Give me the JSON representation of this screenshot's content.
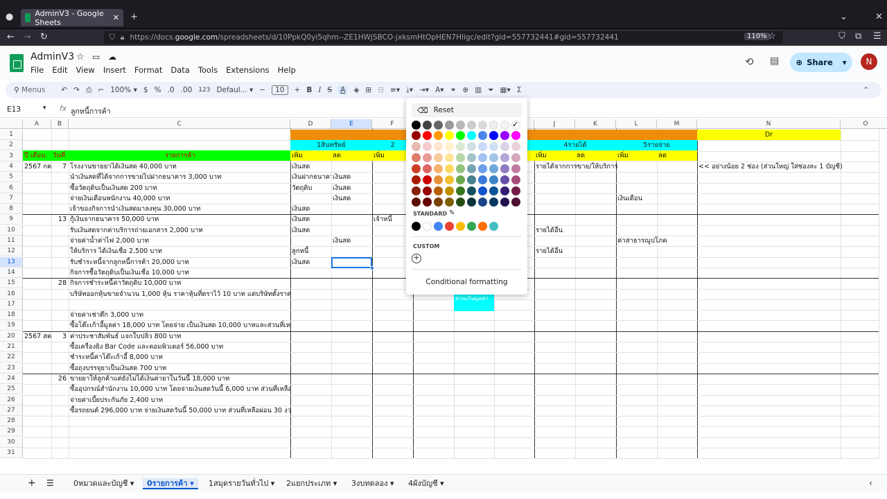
{
  "browser": {
    "tab_title": "AdminV3 - Google Sheets",
    "url_prefix": "https://docs.",
    "url_host": "google.com",
    "url_path": "/spreadsheets/d/10PpkQ0yi5qhm--ZE1HWjSBCO-jxksmHtOpHEN7Hligc/edit?gid=557732441#gid=557732441",
    "zoom": "110%"
  },
  "app": {
    "doc_title": "AdminV3",
    "menu": [
      "File",
      "Edit",
      "View",
      "Insert",
      "Format",
      "Data",
      "Tools",
      "Extensions",
      "Help"
    ],
    "share_label": "Share",
    "avatar_letter": "N"
  },
  "toolbar": {
    "search_label": "Menus",
    "zoom": "100%",
    "currency": "$",
    "percent": "%",
    "dec_less": ".0",
    "dec_more": ".00",
    "number_fmt": "123",
    "font": "Defaul...",
    "font_size": "10"
  },
  "formula_bar": {
    "cell_ref": "E13",
    "content": "ลูกหนี้การค้า"
  },
  "grid": {
    "columns": [
      "A",
      "B",
      "C",
      "D",
      "E",
      "F",
      "G",
      "H",
      "I",
      "J",
      "K",
      "L",
      "M",
      "N",
      "O"
    ],
    "rows": [
      "1",
      "2",
      "3",
      "4",
      "5",
      "6",
      "7",
      "8",
      "9",
      "10",
      "11",
      "12",
      "13",
      "14",
      "15",
      "16",
      "17",
      "18",
      "19",
      "20",
      "21",
      "22",
      "23",
      "24",
      "25",
      "26",
      "27",
      "28",
      "29",
      "30",
      "31"
    ],
    "selected_col": "E",
    "selected_row": "13",
    "row1": {
      "n": "Dr"
    },
    "row2": {
      "d": "1สินทรัพย์",
      "f": "2",
      "j": "4รายได้",
      "l": "5รายจ่าย"
    },
    "row3": {
      "a": "ปี เดือน",
      "b": "วันที่",
      "c": "รายการค้า",
      "d": "เพิ่ม",
      "e": "ลด",
      "f": "เพิ่ม",
      "j": "เพิ่ม",
      "k": "ลด",
      "l": "เพิ่ม",
      "m": "ลด"
    },
    "cells": [
      {
        "row": 4,
        "col": "a",
        "text": "2567 กค"
      },
      {
        "row": 4,
        "col": "b",
        "text": "7"
      },
      {
        "row": 4,
        "col": "c",
        "text": "โรงงานขายยาได้เงินสด 40,000 บาท"
      },
      {
        "row": 4,
        "col": "d",
        "text": "เงินสด"
      },
      {
        "row": 4,
        "col": "j",
        "text": "รายได้จากการขาย/ให้บริการ"
      },
      {
        "row": 4,
        "col": "n",
        "text": "<< อย่างน้อย 2 ช่อง (ส่วนใหญ่ ใส่ช่องละ 1 บัญชี)"
      },
      {
        "row": 5,
        "col": "c",
        "text": "นำเงินสดที่ได้จากการขายไปฝากธนาคาร 3,000 บาท"
      },
      {
        "row": 5,
        "col": "d",
        "text": "เงินฝากธนาคาร"
      },
      {
        "row": 5,
        "col": "e",
        "text": "เงินสด"
      },
      {
        "row": 6,
        "col": "c",
        "text": "ซื้อวัตถุดิบเป็นเงินสด 200 บาท"
      },
      {
        "row": 6,
        "col": "d",
        "text": "วัตถุดิบ"
      },
      {
        "row": 6,
        "col": "e",
        "text": "เงินสด"
      },
      {
        "row": 7,
        "col": "c",
        "text": "จ่ายเงินเดือนพนักงาน 40,000 บาท"
      },
      {
        "row": 7,
        "col": "e",
        "text": "เงินสด"
      },
      {
        "row": 7,
        "col": "l",
        "text": "เงินเดือน"
      },
      {
        "row": 8,
        "col": "c",
        "text": "เจ้าของกิจการนำเงินสดมาลงทุน 30,000 บาท"
      },
      {
        "row": 8,
        "col": "d",
        "text": "เงินสด"
      },
      {
        "row": 9,
        "col": "b",
        "text": "13"
      },
      {
        "row": 9,
        "col": "c",
        "text": "กู้เงินจากธนาคาร 50,000 บาท"
      },
      {
        "row": 9,
        "col": "d",
        "text": "เงินสด"
      },
      {
        "row": 9,
        "col": "f",
        "text": "เจ้าหนี้"
      },
      {
        "row": 10,
        "col": "c",
        "text": "รับเงินสดจากค่าบริการถ่ายเอกสาร 2,000 บาท"
      },
      {
        "row": 10,
        "col": "d",
        "text": "เงินสด"
      },
      {
        "row": 10,
        "col": "j",
        "text": "รายได้อื่น"
      },
      {
        "row": 11,
        "col": "c",
        "text": "จ่ายค่าน้ำค่าไฟ 2,000 บาท"
      },
      {
        "row": 11,
        "col": "e",
        "text": "เงินสด"
      },
      {
        "row": 11,
        "col": "l",
        "text": "ค่าสาธารณูปโภค"
      },
      {
        "row": 12,
        "col": "c",
        "text": "ให้บริการ ได้เงินเชื่อ 2,500 บาท"
      },
      {
        "row": 12,
        "col": "d",
        "text": "ลูกหนี้"
      },
      {
        "row": 12,
        "col": "j",
        "text": "รายได้อื่น"
      },
      {
        "row": 13,
        "col": "c",
        "text": "รับชำระหนี้จากลูกหนี้การค้า 20,000 บาท"
      },
      {
        "row": 13,
        "col": "d",
        "text": "เงินสด"
      },
      {
        "row": 14,
        "col": "c",
        "text": "กิจการซื้อวัตถุดิบเป็นเงินเชื่อ 10,000 บาท"
      },
      {
        "row": 15,
        "col": "b",
        "text": "28"
      },
      {
        "row": 15,
        "col": "c",
        "text": "กิจการชำระหนี้ค่าวัตถุดิบ 10,000 บาท"
      },
      {
        "row": 16,
        "col": "c",
        "text": "บริษัทออกหุ้นขายจำนวน 1,000 หุ้น ราคาหุ้นที่ตราไว้ 10 บาท แต่บริษัทตั้งราค"
      },
      {
        "row": 18,
        "col": "c",
        "text": "จ่ายค่าเช่าตึก 3,000 บาท"
      },
      {
        "row": 19,
        "col": "c",
        "text": "ซื้อโต๊ะเก้าอี้มูลค่า 18,000 บาท โดยจ่าย เป็นเงินสด 10,000 บาทและส่วนที่เหลื"
      },
      {
        "row": 20,
        "col": "a",
        "text": "2567 สค"
      },
      {
        "row": 20,
        "col": "b",
        "text": "3"
      },
      {
        "row": 20,
        "col": "c",
        "text": "ค่าประชาสัมพันธ์ แจกใบปลิว 800 บาท"
      },
      {
        "row": 21,
        "col": "c",
        "text": "ซื้อเครื่องยิง Bar Code และคอมพิวเตอร์ 56,000 บาท"
      },
      {
        "row": 22,
        "col": "c",
        "text": "ชำระหนี้ค่าโต๊ะเก้าอี้ 8,000 บาท"
      },
      {
        "row": 23,
        "col": "c",
        "text": "ซื้อถุงบรรจุยาเป็นเงินสด 700 บาท"
      },
      {
        "row": 24,
        "col": "b",
        "text": "26"
      },
      {
        "row": 24,
        "col": "c",
        "text": "ขายยาให้ลูกค้าแต่ยังไม่ได้เงินค่ายาในวันนี้ 18,000 บาท"
      },
      {
        "row": 25,
        "col": "c",
        "text": "ซื้ออุปกรณ์สำนักงาน 10,000 บาท โดยจ่ายเงินสดวันนี้ 6,000 บาท ส่วนที่เหลือ"
      },
      {
        "row": 26,
        "col": "c",
        "text": "จ่ายค่าเบี้ยประกันภัย 2,400 บาท"
      },
      {
        "row": 27,
        "col": "c",
        "text": "ซื้อรถยนต์ 296,000 บาท จ่ายเงินสดวันนี้ 50,000 บาท ส่วนที่เหลือผ่อน 30 งวด"
      }
    ],
    "hidden_note": "ส่วนเกินมูลค่า"
  },
  "color_popup": {
    "reset_label": "Reset",
    "standard_label": "STANDARD",
    "custom_label": "CUSTOM",
    "conditional_label": "Conditional formatting",
    "palette": [
      [
        "#000000",
        "#434343",
        "#666666",
        "#999999",
        "#b7b7b7",
        "#cccccc",
        "#d9d9d9",
        "#efefef",
        "#f3f3f3",
        "#ffffff"
      ],
      [
        "#980000",
        "#ff0000",
        "#ff9900",
        "#ffff00",
        "#00ff00",
        "#00ffff",
        "#4a86e8",
        "#0000ff",
        "#9900ff",
        "#ff00ff"
      ],
      [
        "#e6b8af",
        "#f4cccc",
        "#fce5cd",
        "#fff2cc",
        "#d9ead3",
        "#d0e0e3",
        "#c9daf8",
        "#cfe2f3",
        "#d9d2e9",
        "#ead1dc"
      ],
      [
        "#dd7e6b",
        "#ea9999",
        "#f9cb9c",
        "#ffe599",
        "#b6d7a8",
        "#a2c4c9",
        "#a4c2f4",
        "#9fc5e8",
        "#b4a7d6",
        "#d5a6bd"
      ],
      [
        "#cc4125",
        "#e06666",
        "#f6b26b",
        "#ffd966",
        "#93c47d",
        "#76a5af",
        "#6d9eeb",
        "#6fa8dc",
        "#8e7cc3",
        "#c27ba0"
      ],
      [
        "#a61c00",
        "#cc0000",
        "#e69138",
        "#f1c232",
        "#6aa84f",
        "#45818e",
        "#3c78d8",
        "#3d85c6",
        "#674ea7",
        "#a64d79"
      ],
      [
        "#85200c",
        "#990000",
        "#b45f06",
        "#bf9000",
        "#38761d",
        "#134f5c",
        "#1155cc",
        "#0b5394",
        "#351c75",
        "#741b47"
      ],
      [
        "#5b0f00",
        "#660000",
        "#783f04",
        "#7f6000",
        "#274e13",
        "#0c343d",
        "#1c4587",
        "#073763",
        "#20124d",
        "#4c1130"
      ]
    ],
    "standard": [
      "#000000",
      "#ffffff",
      "#4285f4",
      "#ea4335",
      "#fbbc04",
      "#34a853",
      "#ff6d01",
      "#46bdc6"
    ]
  },
  "sheet_tabs": [
    "0หมวดและบัญชี",
    "0รายการค้า",
    "1สมุดรายวันทั่วไป",
    "2แยกประเภท",
    "3งบทดลอง",
    "4ผังบัญชี"
  ],
  "active_tab": "0รายการค้า"
}
